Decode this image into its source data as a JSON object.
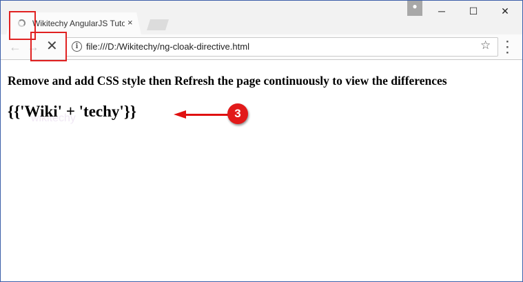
{
  "browser": {
    "tab_title": "Wikitechy AngularJS Tuto",
    "tab_close": "×",
    "url": "file:///D:/Wikitechy/ng-cloak-directive.html",
    "back_icon": "←",
    "forward_icon": "→",
    "stop_icon": "✕",
    "info_icon": "i",
    "star_icon": "☆",
    "menu_icon": "⋮",
    "user_icon": "👤",
    "minimize_icon": "─",
    "maximize_icon": "☐",
    "close_icon": "✕"
  },
  "page": {
    "heading": "Remove and add CSS style then Refresh the page continuously to view the differences",
    "expression": "{{'Wiki' + 'techy'}}",
    "watermark": "wikitechy"
  },
  "annotation": {
    "badge_number": "3",
    "highlight_color": "#e02020"
  }
}
